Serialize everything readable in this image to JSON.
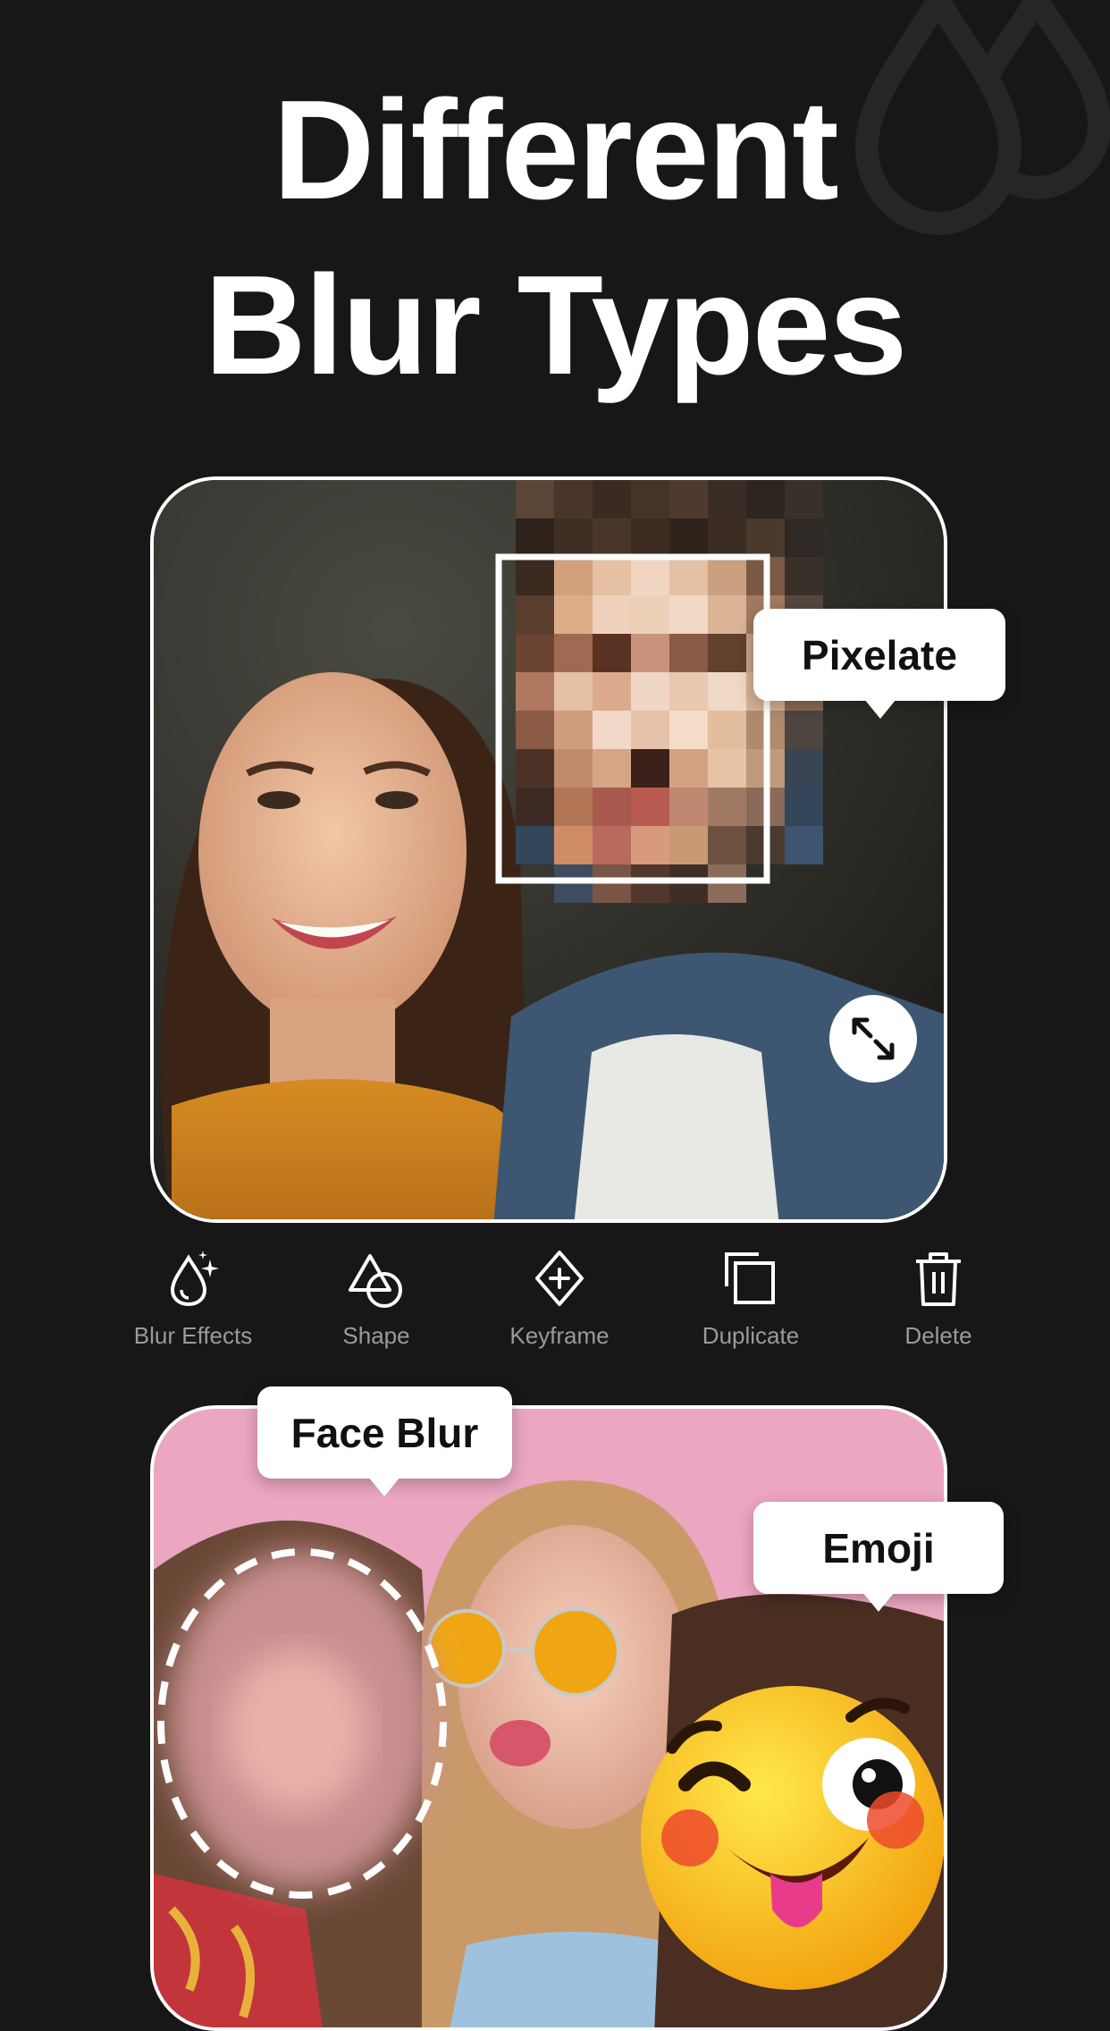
{
  "headline": {
    "line1": "Different",
    "line2": "Blur Types"
  },
  "card_top": {
    "tag": "Pixelate",
    "resize_icon": "diagonal-resize-icon"
  },
  "toolbar": {
    "items": [
      {
        "label": "Blur Effects",
        "icon": "blur-effects-icon"
      },
      {
        "label": "Shape",
        "icon": "shape-icon"
      },
      {
        "label": "Keyframe",
        "icon": "keyframe-icon"
      },
      {
        "label": "Duplicate",
        "icon": "duplicate-icon"
      },
      {
        "label": "Delete",
        "icon": "trash-icon"
      }
    ]
  },
  "card_bottom": {
    "tag_face": "Face Blur",
    "tag_emoji": "Emoji"
  },
  "colors": {
    "background": "#171717",
    "text": "#ffffff",
    "tool_label": "#9a9a9a"
  }
}
